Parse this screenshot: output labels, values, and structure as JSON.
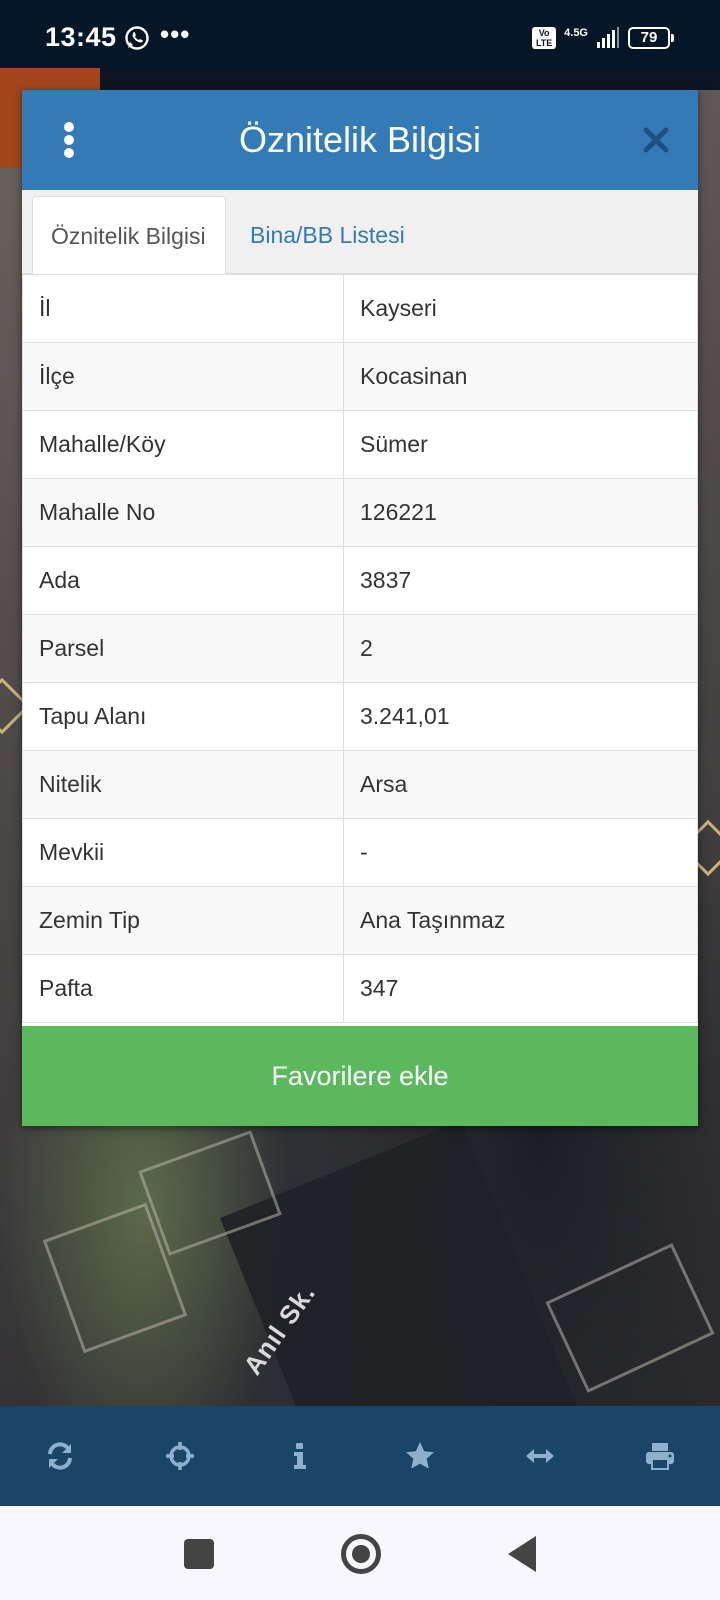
{
  "status_bar": {
    "time": "13:45",
    "more_glyph": "•••",
    "volte_label": "Vo LTE",
    "network_label": "4.5G",
    "battery_level": "79"
  },
  "map": {
    "road_label": "Anıl Sk."
  },
  "dialog": {
    "title": "Öznitelik Bilgisi",
    "tabs": [
      {
        "label": "Öznitelik Bilgisi",
        "active": true
      },
      {
        "label": "Bina/BB Listesi",
        "active": false
      }
    ],
    "rows": [
      {
        "key": "İl",
        "value": "Kayseri"
      },
      {
        "key": "İlçe",
        "value": "Kocasinan"
      },
      {
        "key": "Mahalle/Köy",
        "value": "Sümer"
      },
      {
        "key": "Mahalle No",
        "value": "126221"
      },
      {
        "key": "Ada",
        "value": "3837"
      },
      {
        "key": "Parsel",
        "value": "2"
      },
      {
        "key": "Tapu Alanı",
        "value": "3.241,01"
      },
      {
        "key": "Nitelik",
        "value": "Arsa"
      },
      {
        "key": "Mevkii",
        "value": "-"
      },
      {
        "key": "Zemin Tip",
        "value": "Ana Taşınmaz"
      },
      {
        "key": "Pafta",
        "value": "347"
      }
    ],
    "favorite_button": "Favorilere ekle"
  },
  "toolbar": {
    "icons": [
      "refresh-icon",
      "crosshair-icon",
      "info-icon",
      "star-icon",
      "measure-icon",
      "print-icon"
    ]
  },
  "colors": {
    "header": "#337ab7",
    "favorite": "#5cb85c",
    "toolbar": "#1b4566",
    "toolbar_icon": "#8fb0cc"
  }
}
